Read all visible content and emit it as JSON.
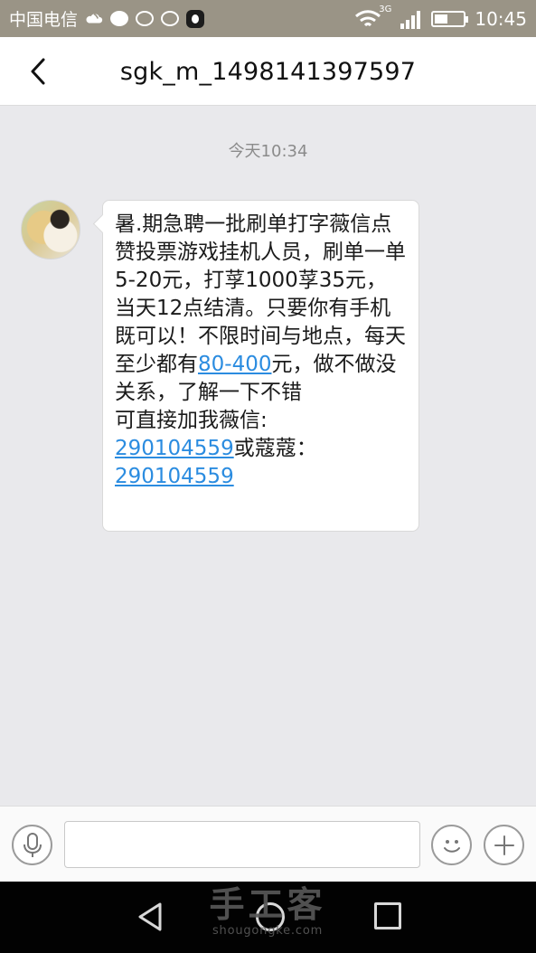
{
  "status_bar": {
    "carrier": "中国电信",
    "network": "3G",
    "time": "10:45",
    "battery_level": 0.45,
    "icons": [
      "weather-icon",
      "message-bubble-icon",
      "chat-ring-icon",
      "chat-ring-icon",
      "qq-icon",
      "wifi-icon",
      "signal-icon",
      "battery-icon"
    ]
  },
  "header": {
    "title": "sgk_m_1498141397597"
  },
  "conversation": {
    "timestamp": "今天10:34",
    "message": {
      "line_1": "暑.期急聘一批刷单打字薇信点赞投票游戏挂机人员，刷单一单5-20元，打莩1000莩35元，当天12点结清。只要你有手机既可以！不限时间与地点，每天至少都有",
      "link_1": "80-400",
      "line_2": "元，做不做没关系，了解一下不错\n可直接加我薇信:\n",
      "link_2": "290104559",
      "line_3": "或蔻蔻：\n",
      "link_3": "290104559"
    }
  },
  "composer": {
    "input_value": ""
  },
  "watermark": {
    "main": "手工客",
    "sub": "shougongke.com"
  },
  "colors": {
    "status_bar": "#9a9486",
    "chat_background": "#e9e9ec",
    "link": "#2b8ce0",
    "navigation_bar": "#020202"
  }
}
